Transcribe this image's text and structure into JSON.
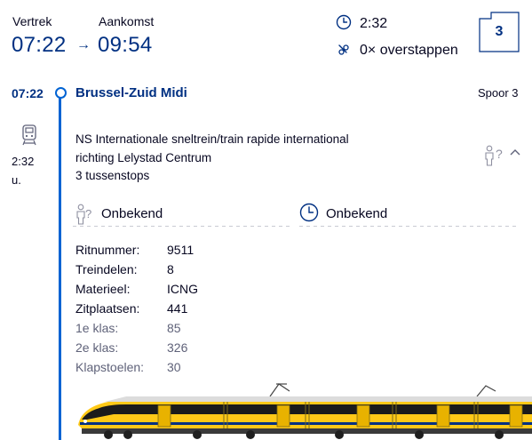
{
  "summary": {
    "departure_label": "Vertrek",
    "departure_time": "07:22",
    "arrow": "→",
    "arrival_label": "Aankomst",
    "arrival_time": "09:54",
    "duration": "2:32",
    "transfers": "0× overstappen",
    "crowd_level": "3"
  },
  "stop": {
    "time": "07:22",
    "station": "Brussel-Zuid Midi",
    "platform": "Spoor 3"
  },
  "leg": {
    "duration": "2:32",
    "duration_unit": "u.",
    "train_name": "NS Internationale sneltrein/train rapide international",
    "direction": "richting Lelystad Centrum",
    "stops": "3 tussenstops",
    "crowd_unknown_label": "Onbekend",
    "punctuality_unknown_label": "Onbekend",
    "question_mark": "?"
  },
  "details": [
    {
      "key": "Ritnummer:",
      "value": "9511",
      "muted": false
    },
    {
      "key": "Treindelen:",
      "value": "8",
      "muted": false
    },
    {
      "key": "Materieel:",
      "value": "ICNG",
      "muted": false
    },
    {
      "key": "Zitplaatsen:",
      "value": "441",
      "muted": false
    },
    {
      "key": "1e klas:",
      "value": "85",
      "muted": true
    },
    {
      "key": "2e klas:",
      "value": "326",
      "muted": true
    },
    {
      "key": "Klapstoelen:",
      "value": "30",
      "muted": true
    }
  ],
  "colors": {
    "ns_blue": "#003082",
    "train_yellow": "#ffc917",
    "text": "#070721",
    "muted": "#5f6279"
  }
}
